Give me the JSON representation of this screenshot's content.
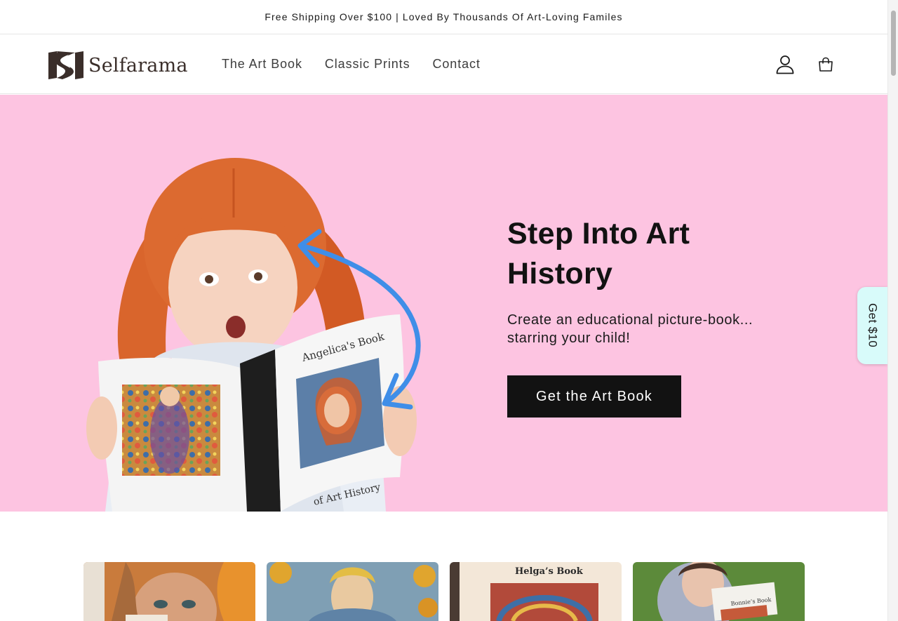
{
  "announcement": {
    "text": "Free Shipping Over $100 | Loved By Thousands Of Art-Loving Familes"
  },
  "header": {
    "logo_text": "Selfarama",
    "nav": [
      {
        "label": "The Art Book"
      },
      {
        "label": "Classic Prints"
      },
      {
        "label": "Contact"
      }
    ],
    "account_icon": "user-icon",
    "cart_icon": "shopping-bag-icon"
  },
  "hero": {
    "title": "Step Into Art History",
    "subtitle": "Create an educational picture-book... starring your child!",
    "cta_label": "Get the Art Book",
    "background_color": "#fdc4e1",
    "book": {
      "cover_title": "Angelica's Book",
      "cover_subtitle": "of Art History"
    }
  },
  "side_tab": {
    "label": "Get $10",
    "color": "#d8fbfa"
  },
  "gallery": {
    "items": [
      {
        "caption": ""
      },
      {
        "caption": ""
      },
      {
        "caption": "Helga’s Book"
      },
      {
        "caption": "Bonnie’s Book"
      }
    ]
  },
  "colors": {
    "primary": "#121212",
    "accent_pink": "#fdc4e1",
    "arrow_blue": "#3f8ee8"
  }
}
